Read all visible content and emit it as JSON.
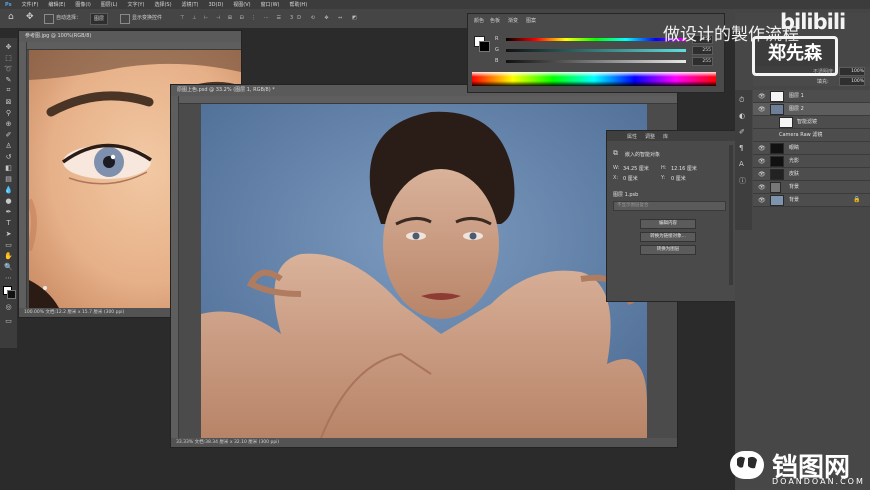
{
  "menubar": {
    "items": [
      "文件(F)",
      "编辑(E)",
      "图像(I)",
      "图层(L)",
      "文字(Y)",
      "选择(S)",
      "滤镜(T)",
      "3D(D)",
      "视图(V)",
      "窗口(W)",
      "帮助(H)"
    ]
  },
  "options_bar": {
    "auto_select_label": "自动选择：",
    "auto_select_value": "图层",
    "show_transform_label": "显示变换控件"
  },
  "doc_left": {
    "tab_title": "参考图.jpg @ 100%(RGB/8)",
    "status": "100.00%  文档:12.2 厘米 x 15.7 厘米 (300 ppi)"
  },
  "doc_main": {
    "tab_title": "原图上色.psd @ 33.2% (图层 1, RGB/8) *",
    "status": "33.33%  文档:38.34 厘米 x 32.10 厘米 (300 ppi)"
  },
  "color_panel": {
    "tabs": [
      "颜色",
      "色板",
      "渐变",
      "图案"
    ],
    "sliders": [
      {
        "label": "R",
        "value": "255"
      },
      {
        "label": "G",
        "value": "255"
      },
      {
        "label": "B",
        "value": "255"
      }
    ]
  },
  "properties_panel": {
    "tabs": [
      "属性",
      "调整",
      "库"
    ],
    "header": "嵌入的智能对象",
    "w_label": "W:",
    "w_value": "34.25 厘米",
    "h_label": "H:",
    "h_value": "12.16 厘米",
    "x_label": "X:",
    "x_value": "0 厘米",
    "y_label": "Y:",
    "y_value": "0 厘米",
    "layer_name": "图层 1.psb",
    "comp_placeholder": "不显示图层复合",
    "buttons": [
      "编辑内容",
      "转换为链接对象...",
      "转换为图层"
    ]
  },
  "layers_panel": {
    "opacity_label": "不透明度:",
    "opacity_value": "100%",
    "fill_label": "填充:",
    "fill_value": "100%",
    "layers": [
      {
        "name": "图层 1",
        "eye": true
      },
      {
        "name": "图层 2",
        "eye": true
      },
      {
        "name": "智能滤镜",
        "eye": true
      },
      {
        "name": "Camera Raw 滤镜",
        "eye": true
      },
      {
        "name": "眼睛",
        "eye": true
      },
      {
        "name": "光影",
        "eye": true
      },
      {
        "name": "皮肤",
        "eye": true
      },
      {
        "name": "背景",
        "eye": true
      },
      {
        "name": "背景",
        "eye": true
      }
    ]
  },
  "watermark": {
    "caption": "做设计的製作流程",
    "logo_text": "郑先森",
    "bilibili": "bilibili",
    "site_name": "铛图网",
    "site_url": "DOANDOAN.COM"
  },
  "colors": {
    "app_bg": "#2b2b2b",
    "panel_bg": "#4a4a4a",
    "photo_bg": "#5c7fa8",
    "accent": "#f4f4f4"
  }
}
